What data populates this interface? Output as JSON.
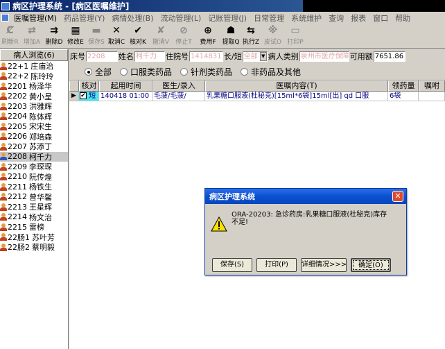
{
  "window": {
    "title": "病区护理系统 - [病区医嘱维护]"
  },
  "menu": [
    "医嘱管理(M)",
    "药品管理(Y)",
    "病情处理(B)",
    "流动管理(L)",
    "记账管理(J)",
    "日常管理",
    "系统维护",
    "查询",
    "报表",
    "窗口",
    "帮助"
  ],
  "toolbar": [
    {
      "label": "刷新R",
      "icon": "Ȼ",
      "on": false
    },
    {
      "label": "增加A",
      "icon": "⇄",
      "on": false
    },
    {
      "label": "删除D",
      "icon": "⇉",
      "on": true
    },
    {
      "label": "修改E",
      "icon": "▦",
      "on": true
    },
    {
      "label": "保存S",
      "icon": "▬",
      "on": false
    },
    {
      "label": "取消C",
      "icon": "✕",
      "on": true
    },
    {
      "label": "核对K",
      "icon": "✔",
      "on": true
    },
    {
      "label": "撤消V",
      "icon": "✘",
      "on": false
    },
    {
      "label": "停止T",
      "icon": "⊘",
      "on": false
    },
    {
      "label": "费用F",
      "icon": "⊕",
      "on": true
    },
    {
      "label": "提取Q",
      "icon": "☗",
      "on": true
    },
    {
      "label": "执行Z",
      "icon": "⇆",
      "on": true
    },
    {
      "label": "皮试O",
      "icon": "※",
      "on": false
    },
    {
      "label": "打印P",
      "icon": "▭",
      "on": false
    }
  ],
  "patient_list": {
    "header": "病人浏览(6)",
    "items": [
      {
        "bed": "22+1",
        "name": "庄庙治"
      },
      {
        "bed": "22+2",
        "name": "陈玲玲"
      },
      {
        "bed": "2201",
        "name": "杨泽华"
      },
      {
        "bed": "2202",
        "name": "黄小呈"
      },
      {
        "bed": "2203",
        "name": "洪雅辉"
      },
      {
        "bed": "2204",
        "name": "陈体辉"
      },
      {
        "bed": "2205",
        "name": "宋宋生"
      },
      {
        "bed": "2206",
        "name": "郑培森"
      },
      {
        "bed": "2207",
        "name": "苏添丁"
      },
      {
        "bed": "2208",
        "name": "柯千力",
        "selected": true
      },
      {
        "bed": "2209",
        "name": "李琛琛"
      },
      {
        "bed": "2210",
        "name": "阮传煌"
      },
      {
        "bed": "2211",
        "name": "杨铁生"
      },
      {
        "bed": "2212",
        "name": "曾华馨"
      },
      {
        "bed": "2213",
        "name": "王星辉"
      },
      {
        "bed": "2214",
        "name": "杨文治"
      },
      {
        "bed": "2215",
        "name": "雷榜"
      },
      {
        "bed": "22肠1",
        "name": "苏叶芳"
      },
      {
        "bed": "22肠2",
        "name": "蔡明毅"
      }
    ]
  },
  "patient_info": {
    "bed_label": "床号",
    "bed_value": "2208",
    "name_label": "姓名",
    "name_value": "柯千力",
    "inpatient_label": "住院号",
    "inpatient_value": "1414831",
    "term_label": "长/短",
    "term_value": "全部",
    "category_label": "病人类别",
    "category_value": "泉州市医疗保障",
    "available_label": "可用额",
    "available_value": "7651.86"
  },
  "filters": {
    "options": [
      "全部",
      "口服类药品",
      "针剂类药品",
      "非药品及其他"
    ],
    "selected": 0
  },
  "grid": {
    "columns": [
      "核对",
      "起用时间",
      "医生/录入",
      "医嘱内容(T)",
      "领药量",
      "嘱咐"
    ],
    "rows": [
      {
        "check": "✔",
        "type": "短",
        "start": "140418 01:00",
        "doctor": "毛菠/毛菠/",
        "content": "乳果糖口服液(杜秘克)[15ml*6袋]15ml[出] qd 口服",
        "qty": "6袋",
        "note": ""
      }
    ]
  },
  "dialog": {
    "title": "病区护理系统",
    "message": "ORA-20203: 急诊药房:乳果糖口服液(杜秘克)库存\n不足!",
    "buttons": {
      "save": "保存(S)",
      "print": "打印(P)",
      "details": "详细情况>>>",
      "ok": "确定(O)"
    }
  }
}
